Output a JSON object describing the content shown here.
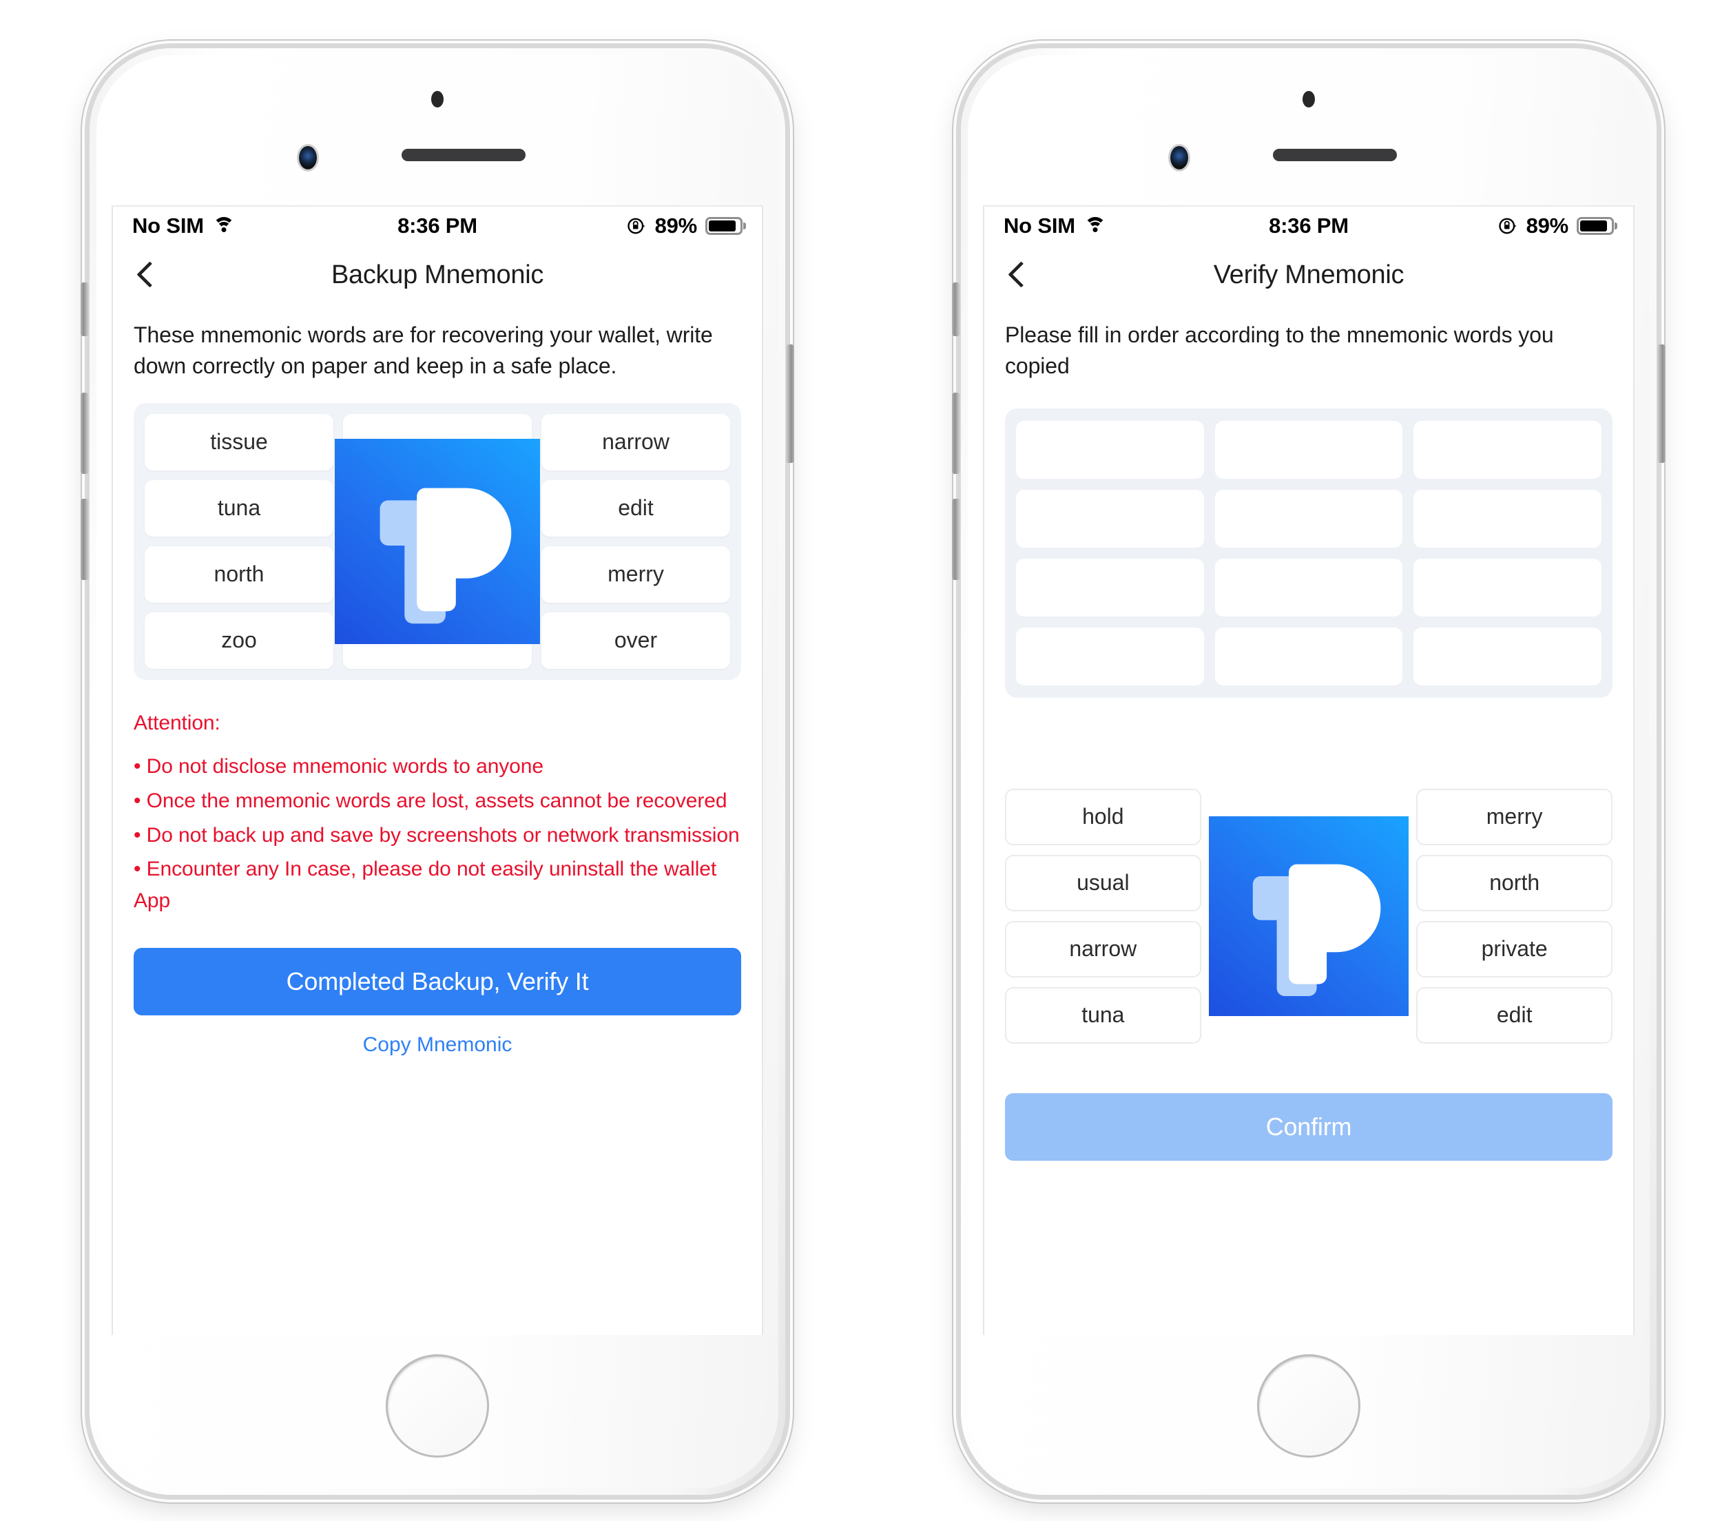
{
  "statusbar": {
    "carrier": "No SIM",
    "wifi_icon": "wifi-icon",
    "time": "8:36 PM",
    "rotation_lock_icon": "rotation-lock-icon",
    "battery_percent": "89%",
    "battery_icon": "battery-icon"
  },
  "colors": {
    "accent_blue": "#2f80f5",
    "accent_blue_disabled": "#96c0f8",
    "warning_red": "#e8112d",
    "panel_bg": "#f0f3f7",
    "logo_gradient_start": "#1d4fe0",
    "logo_gradient_end": "#1aa3ff"
  },
  "backup_screen": {
    "back_icon": "back-chevron-icon",
    "title": "Backup Mnemonic",
    "description": "These mnemonic words are for recovering your wallet, write down correctly on paper and keep in a safe place.",
    "mnemonic_words": [
      "tissue",
      "",
      "narrow",
      "tuna",
      "",
      "edit",
      "north",
      "",
      "merry",
      "zoo",
      "",
      "over"
    ],
    "watermark_logo": "tokenpocket-logo",
    "attention_title": "Attention:",
    "attention_items": [
      "• Do not disclose mnemonic words to anyone",
      "• Once the mnemonic words are lost, assets cannot be recovered",
      "• Do not back up and save by screenshots or network transmission",
      "• Encounter any In case, please do not easily uninstall the wallet App"
    ],
    "primary_button": "Completed Backup, Verify It",
    "link_button": "Copy Mnemonic"
  },
  "verify_screen": {
    "back_icon": "back-chevron-icon",
    "title": "Verify Mnemonic",
    "description": "Please fill in order according to the mnemonic words you copied",
    "slot_count": 12,
    "slots": [
      "",
      "",
      "",
      "",
      "",
      "",
      "",
      "",
      "",
      "",
      "",
      ""
    ],
    "choice_words": [
      "hold",
      "",
      "merry",
      "usual",
      "",
      "north",
      "narrow",
      "",
      "private",
      "tuna",
      "",
      "edit"
    ],
    "watermark_logo": "tokenpocket-logo",
    "confirm_button": "Confirm",
    "confirm_enabled": false
  }
}
